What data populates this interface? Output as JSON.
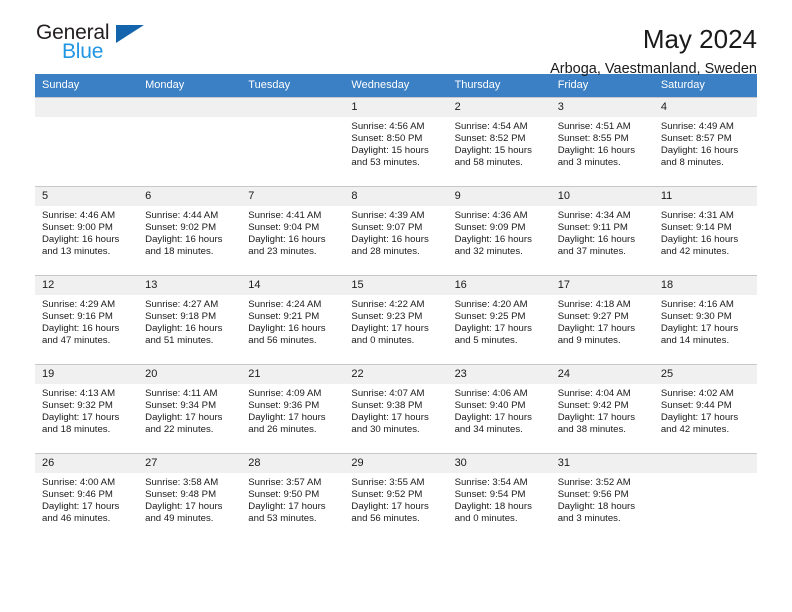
{
  "brand": {
    "name_top": "General",
    "name_bottom": "Blue",
    "flag_color": "#1464ad",
    "blue_text_color": "#2196e3"
  },
  "header": {
    "title": "May 2024",
    "subtitle": "Arboga, Vaestmanland, Sweden"
  },
  "calendar": {
    "header_bg": "#3b7fc4",
    "daynum_bg": "#f0f0f0",
    "grid_line": "#c8c8c8",
    "weekday_headers": [
      "Sunday",
      "Monday",
      "Tuesday",
      "Wednesday",
      "Thursday",
      "Friday",
      "Saturday"
    ],
    "weeks": [
      [
        {
          "day": "",
          "empty": true
        },
        {
          "day": "",
          "empty": true
        },
        {
          "day": "",
          "empty": true
        },
        {
          "day": "1",
          "sunrise": "Sunrise: 4:56 AM",
          "sunset": "Sunset: 8:50 PM",
          "daylight": "Daylight: 15 hours and 53 minutes."
        },
        {
          "day": "2",
          "sunrise": "Sunrise: 4:54 AM",
          "sunset": "Sunset: 8:52 PM",
          "daylight": "Daylight: 15 hours and 58 minutes."
        },
        {
          "day": "3",
          "sunrise": "Sunrise: 4:51 AM",
          "sunset": "Sunset: 8:55 PM",
          "daylight": "Daylight: 16 hours and 3 minutes."
        },
        {
          "day": "4",
          "sunrise": "Sunrise: 4:49 AM",
          "sunset": "Sunset: 8:57 PM",
          "daylight": "Daylight: 16 hours and 8 minutes."
        }
      ],
      [
        {
          "day": "5",
          "sunrise": "Sunrise: 4:46 AM",
          "sunset": "Sunset: 9:00 PM",
          "daylight": "Daylight: 16 hours and 13 minutes."
        },
        {
          "day": "6",
          "sunrise": "Sunrise: 4:44 AM",
          "sunset": "Sunset: 9:02 PM",
          "daylight": "Daylight: 16 hours and 18 minutes."
        },
        {
          "day": "7",
          "sunrise": "Sunrise: 4:41 AM",
          "sunset": "Sunset: 9:04 PM",
          "daylight": "Daylight: 16 hours and 23 minutes."
        },
        {
          "day": "8",
          "sunrise": "Sunrise: 4:39 AM",
          "sunset": "Sunset: 9:07 PM",
          "daylight": "Daylight: 16 hours and 28 minutes."
        },
        {
          "day": "9",
          "sunrise": "Sunrise: 4:36 AM",
          "sunset": "Sunset: 9:09 PM",
          "daylight": "Daylight: 16 hours and 32 minutes."
        },
        {
          "day": "10",
          "sunrise": "Sunrise: 4:34 AM",
          "sunset": "Sunset: 9:11 PM",
          "daylight": "Daylight: 16 hours and 37 minutes."
        },
        {
          "day": "11",
          "sunrise": "Sunrise: 4:31 AM",
          "sunset": "Sunset: 9:14 PM",
          "daylight": "Daylight: 16 hours and 42 minutes."
        }
      ],
      [
        {
          "day": "12",
          "sunrise": "Sunrise: 4:29 AM",
          "sunset": "Sunset: 9:16 PM",
          "daylight": "Daylight: 16 hours and 47 minutes."
        },
        {
          "day": "13",
          "sunrise": "Sunrise: 4:27 AM",
          "sunset": "Sunset: 9:18 PM",
          "daylight": "Daylight: 16 hours and 51 minutes."
        },
        {
          "day": "14",
          "sunrise": "Sunrise: 4:24 AM",
          "sunset": "Sunset: 9:21 PM",
          "daylight": "Daylight: 16 hours and 56 minutes."
        },
        {
          "day": "15",
          "sunrise": "Sunrise: 4:22 AM",
          "sunset": "Sunset: 9:23 PM",
          "daylight": "Daylight: 17 hours and 0 minutes."
        },
        {
          "day": "16",
          "sunrise": "Sunrise: 4:20 AM",
          "sunset": "Sunset: 9:25 PM",
          "daylight": "Daylight: 17 hours and 5 minutes."
        },
        {
          "day": "17",
          "sunrise": "Sunrise: 4:18 AM",
          "sunset": "Sunset: 9:27 PM",
          "daylight": "Daylight: 17 hours and 9 minutes."
        },
        {
          "day": "18",
          "sunrise": "Sunrise: 4:16 AM",
          "sunset": "Sunset: 9:30 PM",
          "daylight": "Daylight: 17 hours and 14 minutes."
        }
      ],
      [
        {
          "day": "19",
          "sunrise": "Sunrise: 4:13 AM",
          "sunset": "Sunset: 9:32 PM",
          "daylight": "Daylight: 17 hours and 18 minutes."
        },
        {
          "day": "20",
          "sunrise": "Sunrise: 4:11 AM",
          "sunset": "Sunset: 9:34 PM",
          "daylight": "Daylight: 17 hours and 22 minutes."
        },
        {
          "day": "21",
          "sunrise": "Sunrise: 4:09 AM",
          "sunset": "Sunset: 9:36 PM",
          "daylight": "Daylight: 17 hours and 26 minutes."
        },
        {
          "day": "22",
          "sunrise": "Sunrise: 4:07 AM",
          "sunset": "Sunset: 9:38 PM",
          "daylight": "Daylight: 17 hours and 30 minutes."
        },
        {
          "day": "23",
          "sunrise": "Sunrise: 4:06 AM",
          "sunset": "Sunset: 9:40 PM",
          "daylight": "Daylight: 17 hours and 34 minutes."
        },
        {
          "day": "24",
          "sunrise": "Sunrise: 4:04 AM",
          "sunset": "Sunset: 9:42 PM",
          "daylight": "Daylight: 17 hours and 38 minutes."
        },
        {
          "day": "25",
          "sunrise": "Sunrise: 4:02 AM",
          "sunset": "Sunset: 9:44 PM",
          "daylight": "Daylight: 17 hours and 42 minutes."
        }
      ],
      [
        {
          "day": "26",
          "sunrise": "Sunrise: 4:00 AM",
          "sunset": "Sunset: 9:46 PM",
          "daylight": "Daylight: 17 hours and 46 minutes."
        },
        {
          "day": "27",
          "sunrise": "Sunrise: 3:58 AM",
          "sunset": "Sunset: 9:48 PM",
          "daylight": "Daylight: 17 hours and 49 minutes."
        },
        {
          "day": "28",
          "sunrise": "Sunrise: 3:57 AM",
          "sunset": "Sunset: 9:50 PM",
          "daylight": "Daylight: 17 hours and 53 minutes."
        },
        {
          "day": "29",
          "sunrise": "Sunrise: 3:55 AM",
          "sunset": "Sunset: 9:52 PM",
          "daylight": "Daylight: 17 hours and 56 minutes."
        },
        {
          "day": "30",
          "sunrise": "Sunrise: 3:54 AM",
          "sunset": "Sunset: 9:54 PM",
          "daylight": "Daylight: 18 hours and 0 minutes."
        },
        {
          "day": "31",
          "sunrise": "Sunrise: 3:52 AM",
          "sunset": "Sunset: 9:56 PM",
          "daylight": "Daylight: 18 hours and 3 minutes."
        },
        {
          "day": "",
          "empty": true
        }
      ]
    ]
  }
}
